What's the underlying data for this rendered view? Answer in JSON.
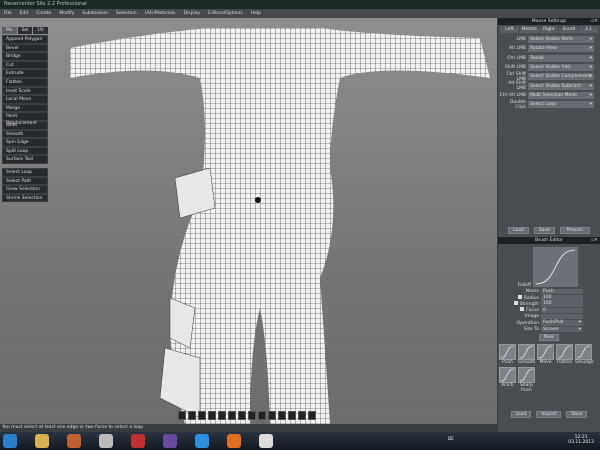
{
  "title": "Nevercenter Silo 2.2 Professional",
  "menu": [
    "File",
    "Edit",
    "Create",
    "Modify",
    "Subdivision",
    "Selection",
    "UVs/Materials",
    "Display",
    "Editors/Options",
    "Help"
  ],
  "left": {
    "tabs": [
      "Mo",
      "Sel",
      "UV"
    ],
    "tools": [
      "Append Polygon",
      "Bevel",
      "Bridge",
      "Cut",
      "Extrude",
      "Flatten",
      "Inset Scale",
      "Local Move",
      "Merge",
      "Point Displacement",
      "Slide",
      "Smooth",
      "Spin Edge",
      "Split Loop",
      "Surface Tool"
    ],
    "select_tools": [
      "Select Loop",
      "Select Path",
      "Grow Selection",
      "Shrink Selection"
    ]
  },
  "mouse": {
    "title": "Mouse Settings",
    "tabs": [
      "Left",
      "Middle",
      "Right",
      "Scroll",
      "3.1"
    ],
    "rows": [
      {
        "label": "LMB",
        "value": "Select Visible Verts"
      },
      {
        "label": "Alt LMB",
        "value": "Rotate View"
      },
      {
        "label": "Ctrl LMB",
        "value": "Tweak"
      },
      {
        "label": "Shift LMB",
        "value": "Select Visible Add"
      },
      {
        "label": "Ctrl Shift LMB",
        "value": "Select Visible Complement"
      },
      {
        "label": "Alt Shift LMB",
        "value": "Select Visible Subtract"
      },
      {
        "label": "Ctrl Alt LMB",
        "value": "Multi Selection Mode"
      },
      {
        "label": "Double Click",
        "value": "Select Loop"
      }
    ],
    "load": "Load",
    "save": "Save",
    "presets": "Presets"
  },
  "brush": {
    "title": "Brush Editor",
    "falloff": "Falloff",
    "name_label": "Name",
    "name": "Push",
    "radius_label": "Radius",
    "radius": "100",
    "strength_label": "Strength",
    "strength": "100",
    "focus_label": "Focus",
    "focus": "0",
    "image_label": "Image",
    "operation_label": "Operation",
    "operation": "Push/Pull",
    "size_label": "Size To",
    "size": "Screen",
    "new": "New",
    "brushes": [
      "Push",
      "Smooth",
      "Move",
      "Flatten",
      "Smudge",
      "Pinch",
      "Sharp Push"
    ],
    "load": "Load",
    "import": "Import",
    "save": "Save"
  },
  "status": "You must select at least one edge or two faces to select a loop",
  "tray": {
    "lang": "DE",
    "time": "12:21",
    "date": "03.11.2013"
  },
  "taskbar_colors": [
    "#2d7fd0",
    "#d8b050",
    "#c06030",
    "#bbbbbb",
    "#c03030",
    "#6a4aa0",
    "#2a90e0",
    "#e07020",
    "#dddddd"
  ]
}
